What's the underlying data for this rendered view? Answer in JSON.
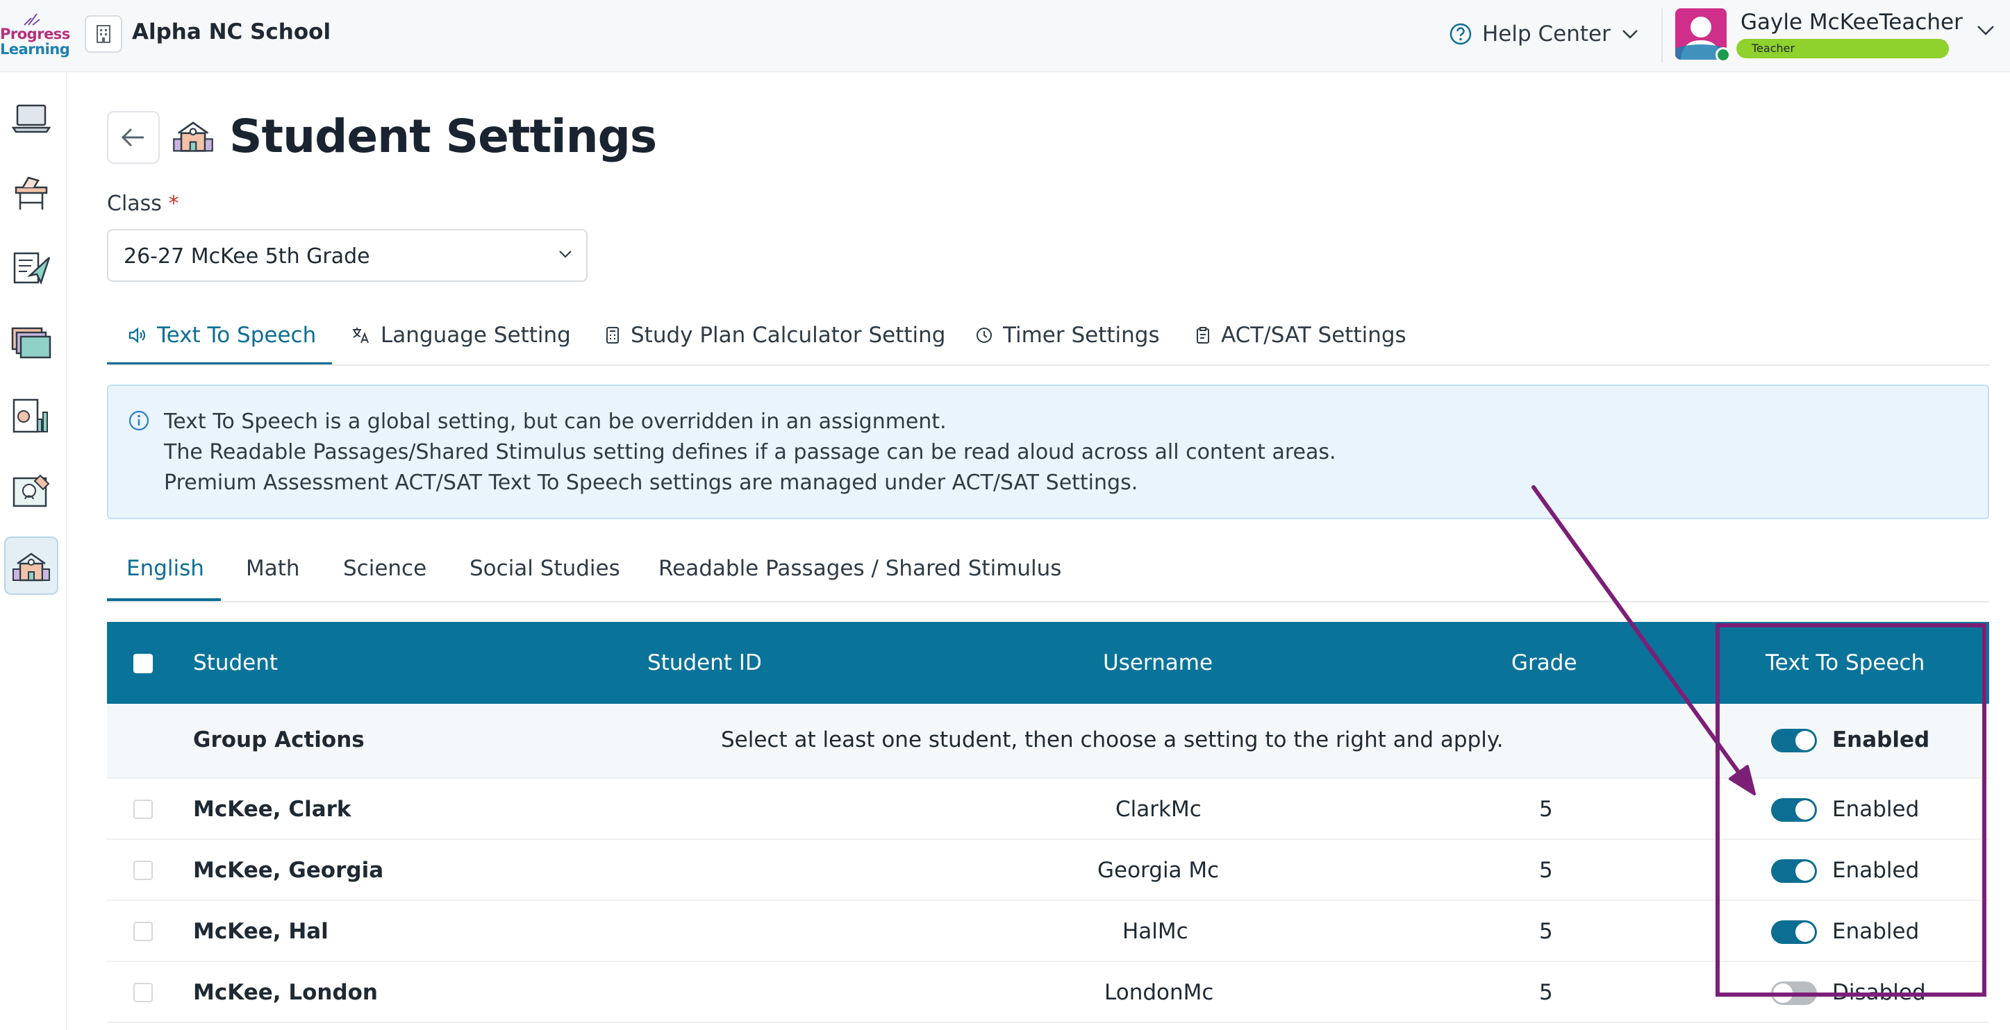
{
  "header": {
    "logo_line1": "Progress",
    "logo_line2": "Learning",
    "school_name": "Alpha NC School",
    "help_label": "Help Center",
    "user_name": "Gayle McKeeTeacher",
    "user_role": "Teacher"
  },
  "sidebar": {
    "items": [
      {
        "icon": "laptop-icon"
      },
      {
        "icon": "desk-icon"
      },
      {
        "icon": "assignment-send-icon"
      },
      {
        "icon": "folders-icon"
      },
      {
        "icon": "report-chart-icon"
      },
      {
        "icon": "gradebook-icon"
      },
      {
        "icon": "school-icon",
        "active": true
      }
    ]
  },
  "page": {
    "title": "Student Settings",
    "class_label": "Class",
    "class_required_mark": "*",
    "class_value": "26-27 McKee 5th Grade"
  },
  "settings_tabs": [
    {
      "label": "Text To Speech",
      "icon": "speaker-icon",
      "active": true
    },
    {
      "label": "Language Setting",
      "icon": "translate-icon"
    },
    {
      "label": "Study Plan Calculator Setting",
      "icon": "calculator-icon"
    },
    {
      "label": "Timer Settings",
      "icon": "clock-icon"
    },
    {
      "label": "ACT/SAT Settings",
      "icon": "clipboard-icon"
    }
  ],
  "info": {
    "line1": "Text To Speech is a global setting, but can be overridden in an assignment.",
    "line2": "The Readable Passages/Shared Stimulus setting defines if a passage can be read aloud across all content areas.",
    "line3": "Premium Assessment ACT/SAT Text To Speech settings are managed under ACT/SAT Settings."
  },
  "subject_tabs": [
    {
      "label": "English",
      "active": true
    },
    {
      "label": "Math"
    },
    {
      "label": "Science"
    },
    {
      "label": "Social Studies"
    },
    {
      "label": "Readable Passages / Shared Stimulus"
    }
  ],
  "table": {
    "headers": {
      "student": "Student",
      "student_id": "Student ID",
      "username": "Username",
      "grade": "Grade",
      "tts": "Text To Speech"
    },
    "group_actions": {
      "label": "Group Actions",
      "hint": "Select at least one student, then choose a setting to the right and apply.",
      "state": "Enabled",
      "enabled": true
    },
    "rows": [
      {
        "student": "McKee, Clark",
        "student_id": "",
        "username": "ClarkMc",
        "grade": "5",
        "state": "Enabled",
        "enabled": true
      },
      {
        "student": "McKee, Georgia",
        "student_id": "",
        "username": "Georgia Mc",
        "grade": "5",
        "state": "Enabled",
        "enabled": true
      },
      {
        "student": "McKee, Hal",
        "student_id": "",
        "username": "HalMc",
        "grade": "5",
        "state": "Enabled",
        "enabled": true
      },
      {
        "student": "McKee, London",
        "student_id": "",
        "username": "LondonMc",
        "grade": "5",
        "state": "Disabled",
        "enabled": false
      }
    ]
  },
  "colors": {
    "accent": "#0c6e93",
    "table_header": "#0a739a",
    "annotation": "#7c1f77",
    "role_badge": "#8fd12d"
  }
}
